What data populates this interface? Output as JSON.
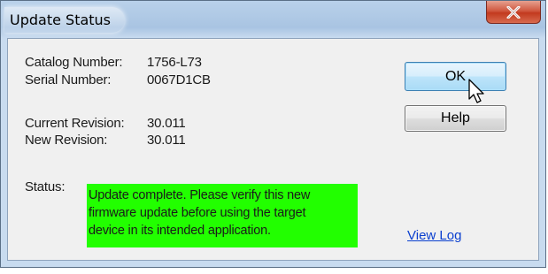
{
  "window": {
    "title": "Update Status"
  },
  "info": {
    "catalog_label": "Catalog Number:",
    "catalog_value": "1756-L73",
    "serial_label": "Serial Number:",
    "serial_value": "0067D1CB",
    "current_label": "Current Revision:",
    "current_value": "30.011",
    "new_label": "New Revision:",
    "new_value": "30.011"
  },
  "status": {
    "label": "Status:",
    "lines": [
      "Update complete. Please verify this new",
      "firmware update before using the target",
      "device in its intended application."
    ],
    "highlight_color": "#22ff00"
  },
  "buttons": {
    "ok": "OK",
    "help": "Help"
  },
  "links": {
    "view_log": "View Log"
  },
  "icons": {
    "close": "close-icon",
    "cursor": "mouse-pointer-icon"
  }
}
